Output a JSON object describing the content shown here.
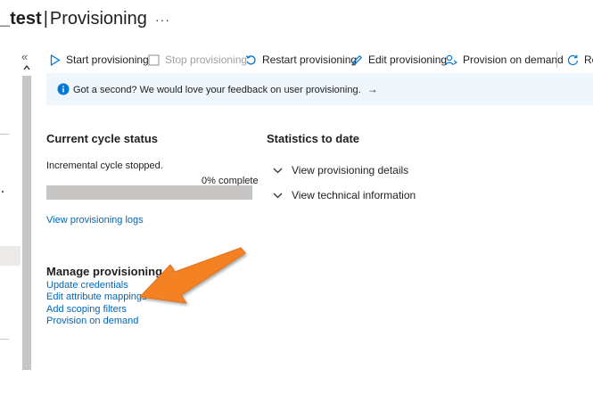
{
  "header": {
    "title_app": "_test",
    "title_separator": "|",
    "title_page": "Provisioning",
    "more_label": "···"
  },
  "sidebar": {
    "collapse_label": "«"
  },
  "toolbar": {
    "start": "Start provisioning",
    "stop": "Stop provisioning",
    "restart": "Restart provisioning",
    "edit": "Edit provisioning",
    "on_demand": "Provision on demand",
    "refresh": "Re"
  },
  "banner": {
    "text": "Got a second? We would love your feedback on user provisioning.",
    "arrow": "→"
  },
  "cycle": {
    "heading": "Current cycle status",
    "status": "Incremental cycle stopped.",
    "percent_text": "0% complete",
    "progress": 0,
    "logs_link": "View provisioning logs"
  },
  "stats": {
    "heading": "Statistics to date",
    "details": "View provisioning details",
    "technical": "View technical information"
  },
  "manage": {
    "heading": "Manage provisioning",
    "links": [
      "Update credentials",
      "Edit attribute mappings",
      "Add scoping filters",
      "Provision on demand"
    ]
  },
  "colors": {
    "accent": "#0078d4",
    "link": "#0067b8",
    "annotation_arrow": "#f58220",
    "banner_bg": "#eff6fc"
  }
}
